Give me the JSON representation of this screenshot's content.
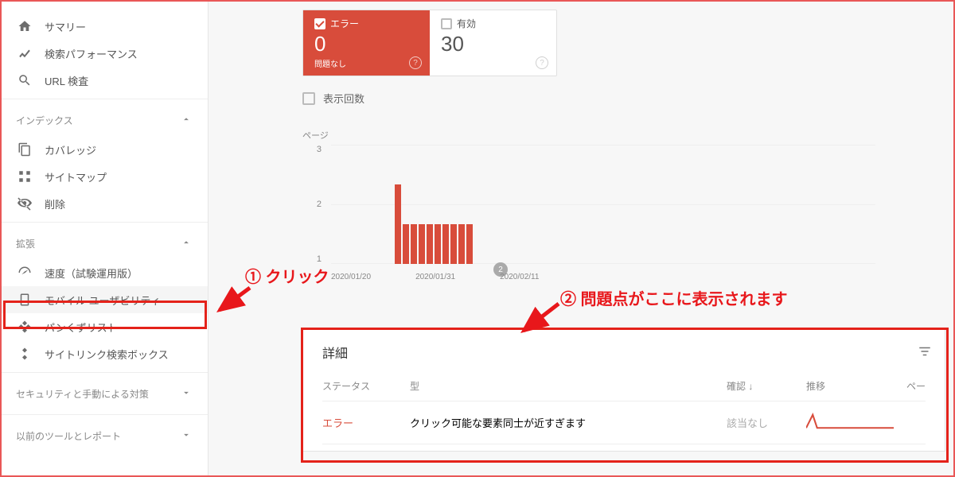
{
  "sidebar": {
    "top_items": [
      {
        "label": "サマリー",
        "icon": "home"
      },
      {
        "label": "検索パフォーマンス",
        "icon": "trend"
      },
      {
        "label": "URL 検査",
        "icon": "search"
      }
    ],
    "index_section": {
      "title": "インデックス",
      "items": [
        {
          "label": "カバレッジ",
          "icon": "copy"
        },
        {
          "label": "サイトマップ",
          "icon": "sitemap"
        },
        {
          "label": "削除",
          "icon": "hide"
        }
      ]
    },
    "enhance_section": {
      "title": "拡張",
      "items": [
        {
          "label": "速度（試験運用版）",
          "icon": "speed"
        },
        {
          "label": "モバイル ユーザビリティ",
          "icon": "mobile"
        },
        {
          "label": "パンくずリスト",
          "icon": "breadcrumb"
        },
        {
          "label": "サイトリンク検索ボックス",
          "icon": "searchbox"
        }
      ]
    },
    "security_section": {
      "title": "セキュリティと手動による対策"
    },
    "legacy_section": {
      "title": "以前のツールとレポート"
    }
  },
  "cards": {
    "error": {
      "label": "エラー",
      "value": "0",
      "sub": "問題なし"
    },
    "valid": {
      "label": "有効",
      "value": "30"
    }
  },
  "impressions_label": "表示回数",
  "chart_data": {
    "type": "bar",
    "ylabel": "ページ",
    "ylim": [
      0,
      3
    ],
    "yticks": [
      "3",
      "2",
      "1"
    ],
    "xticks": [
      "2020/01/20",
      "2020/01/31",
      "2020/02/11"
    ],
    "marker_value": "2",
    "series": [
      {
        "name": "errors",
        "values": [
          0,
          0,
          0,
          0,
          0,
          2,
          1,
          1,
          1,
          1,
          1,
          1,
          1,
          1,
          1,
          0,
          0,
          0,
          0,
          0,
          0,
          0,
          0,
          0,
          0,
          0,
          0,
          0,
          0,
          0
        ]
      }
    ]
  },
  "details": {
    "title": "詳細",
    "columns": {
      "status": "ステータス",
      "type": "型",
      "confirm": "確認",
      "trend": "推移",
      "pages": "ペー"
    },
    "rows": [
      {
        "status": "エラー",
        "type": "クリック可能な要素同士が近すぎます",
        "confirm": "該当なし"
      }
    ]
  },
  "annotations": {
    "a1": "① クリック",
    "a2": "② 問題点がここに表示されます"
  }
}
